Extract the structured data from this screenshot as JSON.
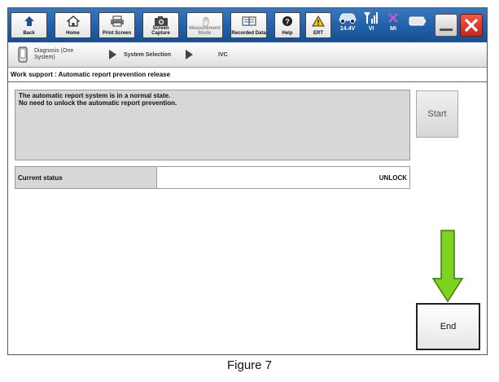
{
  "toolbar": {
    "buttons": [
      {
        "label": "Back",
        "icon": "back-arrow-icon"
      },
      {
        "label": "Home",
        "icon": "home-icon"
      },
      {
        "label": "Print Screen",
        "icon": "printer-icon"
      },
      {
        "label": "Screen Capture",
        "icon": "camera-icon"
      },
      {
        "label": "Measurement Mode",
        "icon": "hand-icon"
      },
      {
        "label": "Recorded Data",
        "icon": "recorded-data-icon"
      },
      {
        "label": "Help",
        "icon": "help-icon"
      },
      {
        "label": "ERT",
        "icon": "warning-icon"
      }
    ],
    "status": {
      "voltage": "14.4V",
      "vi": "VI",
      "mi": "MI"
    }
  },
  "breadcrumb": {
    "step1": "Diagnosis (One System)",
    "step2": "System Selection",
    "step3": "IVC"
  },
  "page": {
    "title": "Work support : Automatic report prevention release"
  },
  "message": {
    "line1": "The automatic report system is in a normal state.",
    "line2": "No need to unlock the automatic report prevention."
  },
  "buttons": {
    "start": "Start",
    "end": "End"
  },
  "status_row": {
    "label": "Current status",
    "value": "UNLOCK"
  },
  "caption": "Figure 7",
  "colors": {
    "toolbar": "#1f5ea7",
    "arrow": "#7ed321",
    "close": "#d9382a"
  }
}
